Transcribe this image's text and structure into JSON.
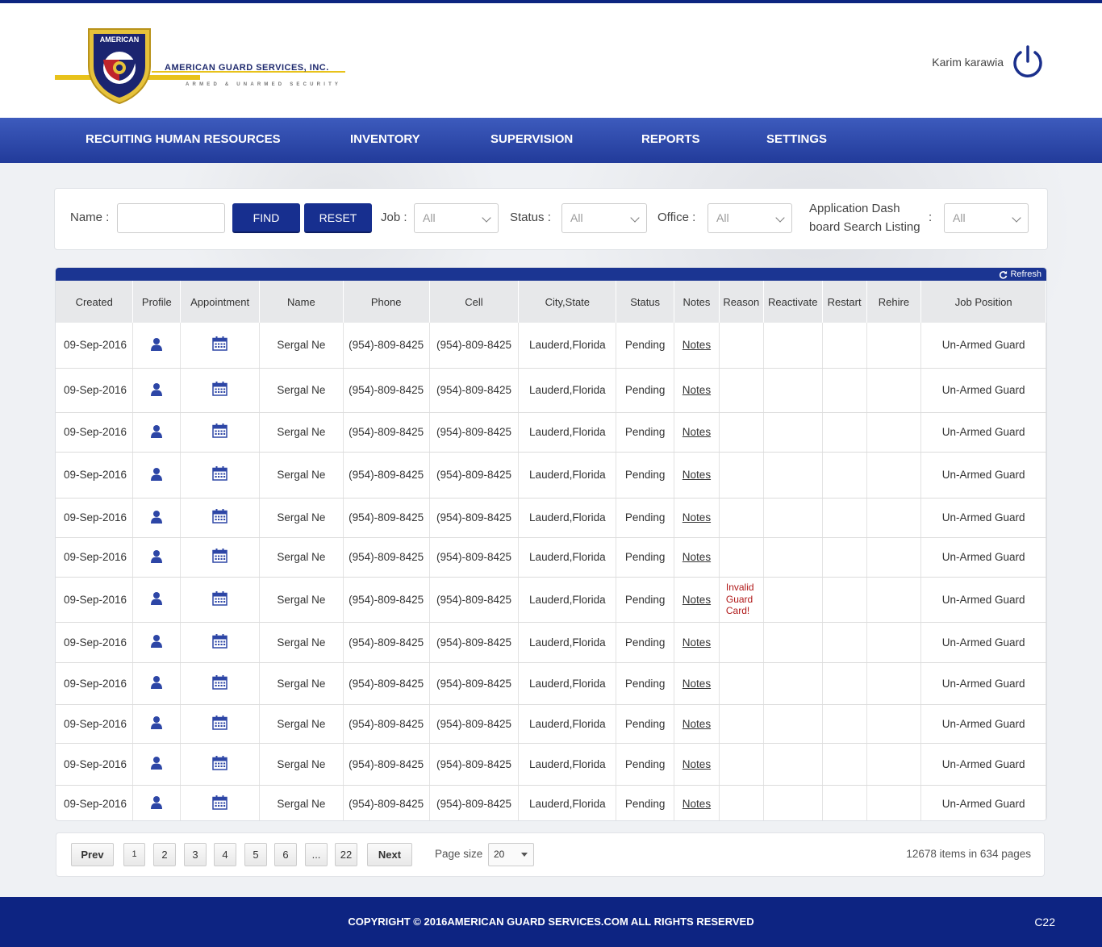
{
  "brand": {
    "company": "AMERICAN GUARD SERVICES, INC.",
    "tagline": "ARMED & UNARMED SECURITY",
    "badge_text": "AMERICAN"
  },
  "user": {
    "name": "Karim karawia",
    "logout_icon": "power-icon"
  },
  "nav": [
    {
      "label": "RECUITING HUMAN RESOURCES"
    },
    {
      "label": "INVENTORY"
    },
    {
      "label": "SUPERVISION"
    },
    {
      "label": "REPORTS"
    },
    {
      "label": "SETTINGS"
    }
  ],
  "filters": {
    "name_label": "Name :",
    "name_value": "",
    "find": "FIND",
    "reset": "RESET",
    "job_label": "Job :",
    "job_value": "All",
    "status_label": "Status :",
    "status_value": "All",
    "office_label": "Office :",
    "office_value": "All",
    "listing_label_1": "Application Dash",
    "listing_label_2": "board Search Listing",
    "listing_colon": ":",
    "listing_value": "All"
  },
  "grid": {
    "refresh": "Refresh",
    "columns": [
      "Created",
      "Profile",
      "Appointment",
      "Name",
      "Phone",
      "Cell",
      "City,State",
      "Status",
      "Notes",
      "Reason",
      "Reactivate",
      "Restart",
      "Rehire",
      "Job Position"
    ],
    "rows": [
      {
        "created": "09-Sep-2016",
        "name": "Sergal Ne",
        "phone": "(954)-809-8425",
        "cell": "(954)-809-8425",
        "city": "Lauderd,Florida",
        "status": "Pending",
        "notes": "Notes",
        "reason": "",
        "job": "Un-Armed Guard"
      },
      {
        "created": "09-Sep-2016",
        "name": "Sergal Ne",
        "phone": "(954)-809-8425",
        "cell": "(954)-809-8425",
        "city": "Lauderd,Florida",
        "status": "Pending",
        "notes": "Notes",
        "reason": "",
        "job": "Un-Armed Guard"
      },
      {
        "created": "09-Sep-2016",
        "name": "Sergal Ne",
        "phone": "(954)-809-8425",
        "cell": "(954)-809-8425",
        "city": "Lauderd,Florida",
        "status": "Pending",
        "notes": "Notes",
        "reason": "",
        "job": "Un-Armed Guard"
      },
      {
        "created": "09-Sep-2016",
        "name": "Sergal Ne",
        "phone": "(954)-809-8425",
        "cell": "(954)-809-8425",
        "city": "Lauderd,Florida",
        "status": "Pending",
        "notes": "Notes",
        "reason": "",
        "job": "Un-Armed Guard"
      },
      {
        "created": "09-Sep-2016",
        "name": "Sergal Ne",
        "phone": "(954)-809-8425",
        "cell": "(954)-809-8425",
        "city": "Lauderd,Florida",
        "status": "Pending",
        "notes": "Notes",
        "reason": "",
        "job": "Un-Armed Guard"
      },
      {
        "created": "09-Sep-2016",
        "name": "Sergal Ne",
        "phone": "(954)-809-8425",
        "cell": "(954)-809-8425",
        "city": "Lauderd,Florida",
        "status": "Pending",
        "notes": "Notes",
        "reason": "",
        "job": "Un-Armed Guard"
      },
      {
        "created": "09-Sep-2016",
        "name": "Sergal Ne",
        "phone": "(954)-809-8425",
        "cell": "(954)-809-8425",
        "city": "Lauderd,Florida",
        "status": "Pending",
        "notes": "Notes",
        "reason": "Invalid Guard Card!",
        "job": "Un-Armed Guard"
      },
      {
        "created": "09-Sep-2016",
        "name": "Sergal Ne",
        "phone": "(954)-809-8425",
        "cell": "(954)-809-8425",
        "city": "Lauderd,Florida",
        "status": "Pending",
        "notes": "Notes",
        "reason": "",
        "job": "Un-Armed Guard"
      },
      {
        "created": "09-Sep-2016",
        "name": "Sergal Ne",
        "phone": "(954)-809-8425",
        "cell": "(954)-809-8425",
        "city": "Lauderd,Florida",
        "status": "Pending",
        "notes": "Notes",
        "reason": "",
        "job": "Un-Armed Guard"
      },
      {
        "created": "09-Sep-2016",
        "name": "Sergal Ne",
        "phone": "(954)-809-8425",
        "cell": "(954)-809-8425",
        "city": "Lauderd,Florida",
        "status": "Pending",
        "notes": "Notes",
        "reason": "",
        "job": "Un-Armed Guard"
      },
      {
        "created": "09-Sep-2016",
        "name": "Sergal Ne",
        "phone": "(954)-809-8425",
        "cell": "(954)-809-8425",
        "city": "Lauderd,Florida",
        "status": "Pending",
        "notes": "Notes",
        "reason": "",
        "job": "Un-Armed Guard"
      },
      {
        "created": "09-Sep-2016",
        "name": "Sergal Ne",
        "phone": "(954)-809-8425",
        "cell": "(954)-809-8425",
        "city": "Lauderd,Florida",
        "status": "Pending",
        "notes": "Notes",
        "reason": "",
        "job": "Un-Armed Guard"
      }
    ],
    "profile_icon": "user-icon",
    "appointment_icon": "calendar-icon"
  },
  "pager": {
    "prev": "Prev",
    "pages": [
      "1",
      "2",
      "3",
      "4",
      "5",
      "6",
      "...",
      "22"
    ],
    "next": "Next",
    "page_size_label": "Page size",
    "page_size_value": "20",
    "info": "12678 items in 634 pages"
  },
  "footer": {
    "copyright": "COPYRIGHT © 2016AMERICAN GUARD SERVICES.COM ALL RIGHTS RESERVED",
    "code": "C22"
  },
  "colors": {
    "brand_blue": "#172f8f",
    "nav_blue": "#2b46a8",
    "footer_blue": "#0d2482",
    "gold": "#e8c21a",
    "reason_red": "#b01818"
  }
}
